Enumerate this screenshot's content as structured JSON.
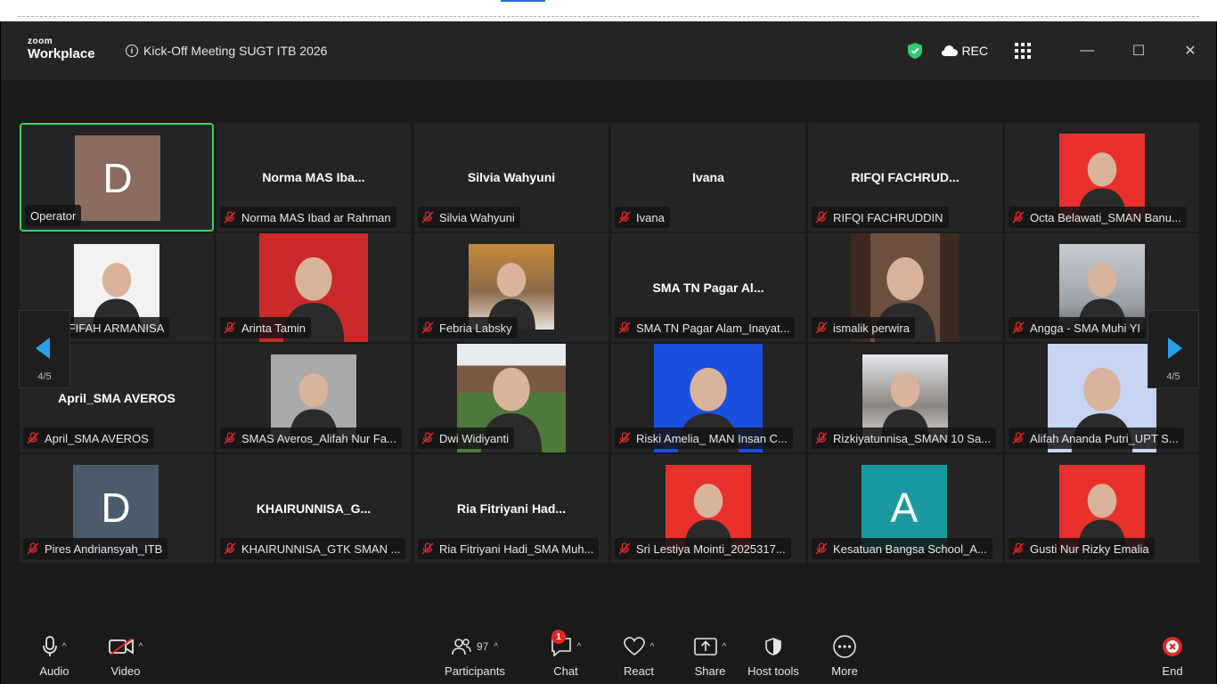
{
  "window": {
    "brand_top": "zoom",
    "brand_bottom": "Workplace",
    "meeting_title": "Kick-Off Meeting SUGT ITB 2026",
    "rec_label": "REC",
    "minimize": "—",
    "maximize": "☐",
    "close": "✕"
  },
  "colors": {
    "accent": "#27a1e8",
    "active_border": "#3fd15e",
    "mute_red": "#e02828",
    "end_red": "#e02828"
  },
  "pagination": {
    "left": "4/5",
    "right": "4/5"
  },
  "tiles": [
    {
      "label": "Operator",
      "avatar": "D",
      "avatar_color": "#8b6b5f",
      "active": true,
      "muted": false
    },
    {
      "label": "Norma MAS Ibad ar Rahman",
      "center": "Norma MAS Iba...",
      "muted": true
    },
    {
      "label": "Silvia Wahyuni",
      "center": "Silvia Wahyuni",
      "muted": true
    },
    {
      "label": "Ivana",
      "center": "Ivana",
      "muted": true
    },
    {
      "label": "RIFQI FACHRUDDIN",
      "center": "RIFQI FACHRUD...",
      "muted": true
    },
    {
      "label": "Octa Belawati_SMAN Banu...",
      "photo": "red",
      "muted": true
    },
    {
      "label": "KHAFIFAH ARMANISA",
      "photo": "white",
      "muted": true
    },
    {
      "label": "Arinta Tamin",
      "photo": "red-wide",
      "muted": true
    },
    {
      "label": "Febria Labsky",
      "photo": "warm",
      "muted": true
    },
    {
      "label": "SMA TN Pagar Alam_Inayat...",
      "center": "SMA TN Pagar Al...",
      "muted": true
    },
    {
      "label": "ismalik perwira",
      "photo": "batik",
      "muted": true
    },
    {
      "label": "Angga - SMA Muhi YI",
      "photo": "sky",
      "muted": true
    },
    {
      "label": "April_SMA AVEROS",
      "center": "April_SMA AVEROS",
      "muted": true
    },
    {
      "label": "SMAS Averos_Alifah Nur Fa...",
      "photo": "gray",
      "muted": true
    },
    {
      "label": "Dwi Widiyanti",
      "photo": "garden",
      "muted": true
    },
    {
      "label": "Riski Amelia_ MAN Insan C...",
      "photo": "blue-wide",
      "muted": true
    },
    {
      "label": "Rizkiyatunnisa_SMAN 10 Sa...",
      "photo": "forest",
      "muted": true
    },
    {
      "label": "Alifah Ananda Putri_UPT S...",
      "photo": "lavender",
      "muted": true
    },
    {
      "label": "Pires Andriansyah_ITB",
      "avatar": "D",
      "avatar_color": "#4a5b6b",
      "muted": true
    },
    {
      "label": "KHAIRUNNISA_GTK SMAN ...",
      "center": "KHAIRUNNISA_G...",
      "muted": true
    },
    {
      "label": "Ria Fitriyani Hadi_SMA Muh...",
      "center": "Ria Fitriyani Had...",
      "muted": true
    },
    {
      "label": "Sri Lestiya Mointi_2025317...",
      "photo": "red",
      "muted": true
    },
    {
      "label": "Kesatuan Bangsa School_A...",
      "avatar": "A",
      "avatar_color": "#1a9aa0",
      "muted": true
    },
    {
      "label": "Gusti Nur Rizky Emalia",
      "photo": "red",
      "muted": true
    }
  ],
  "toolbar": {
    "audio": "Audio",
    "video": "Video",
    "participants": "Participants",
    "participants_count": "97",
    "chat": "Chat",
    "chat_badge": "1",
    "react": "React",
    "share": "Share",
    "host_tools": "Host tools",
    "more": "More",
    "end": "End"
  }
}
